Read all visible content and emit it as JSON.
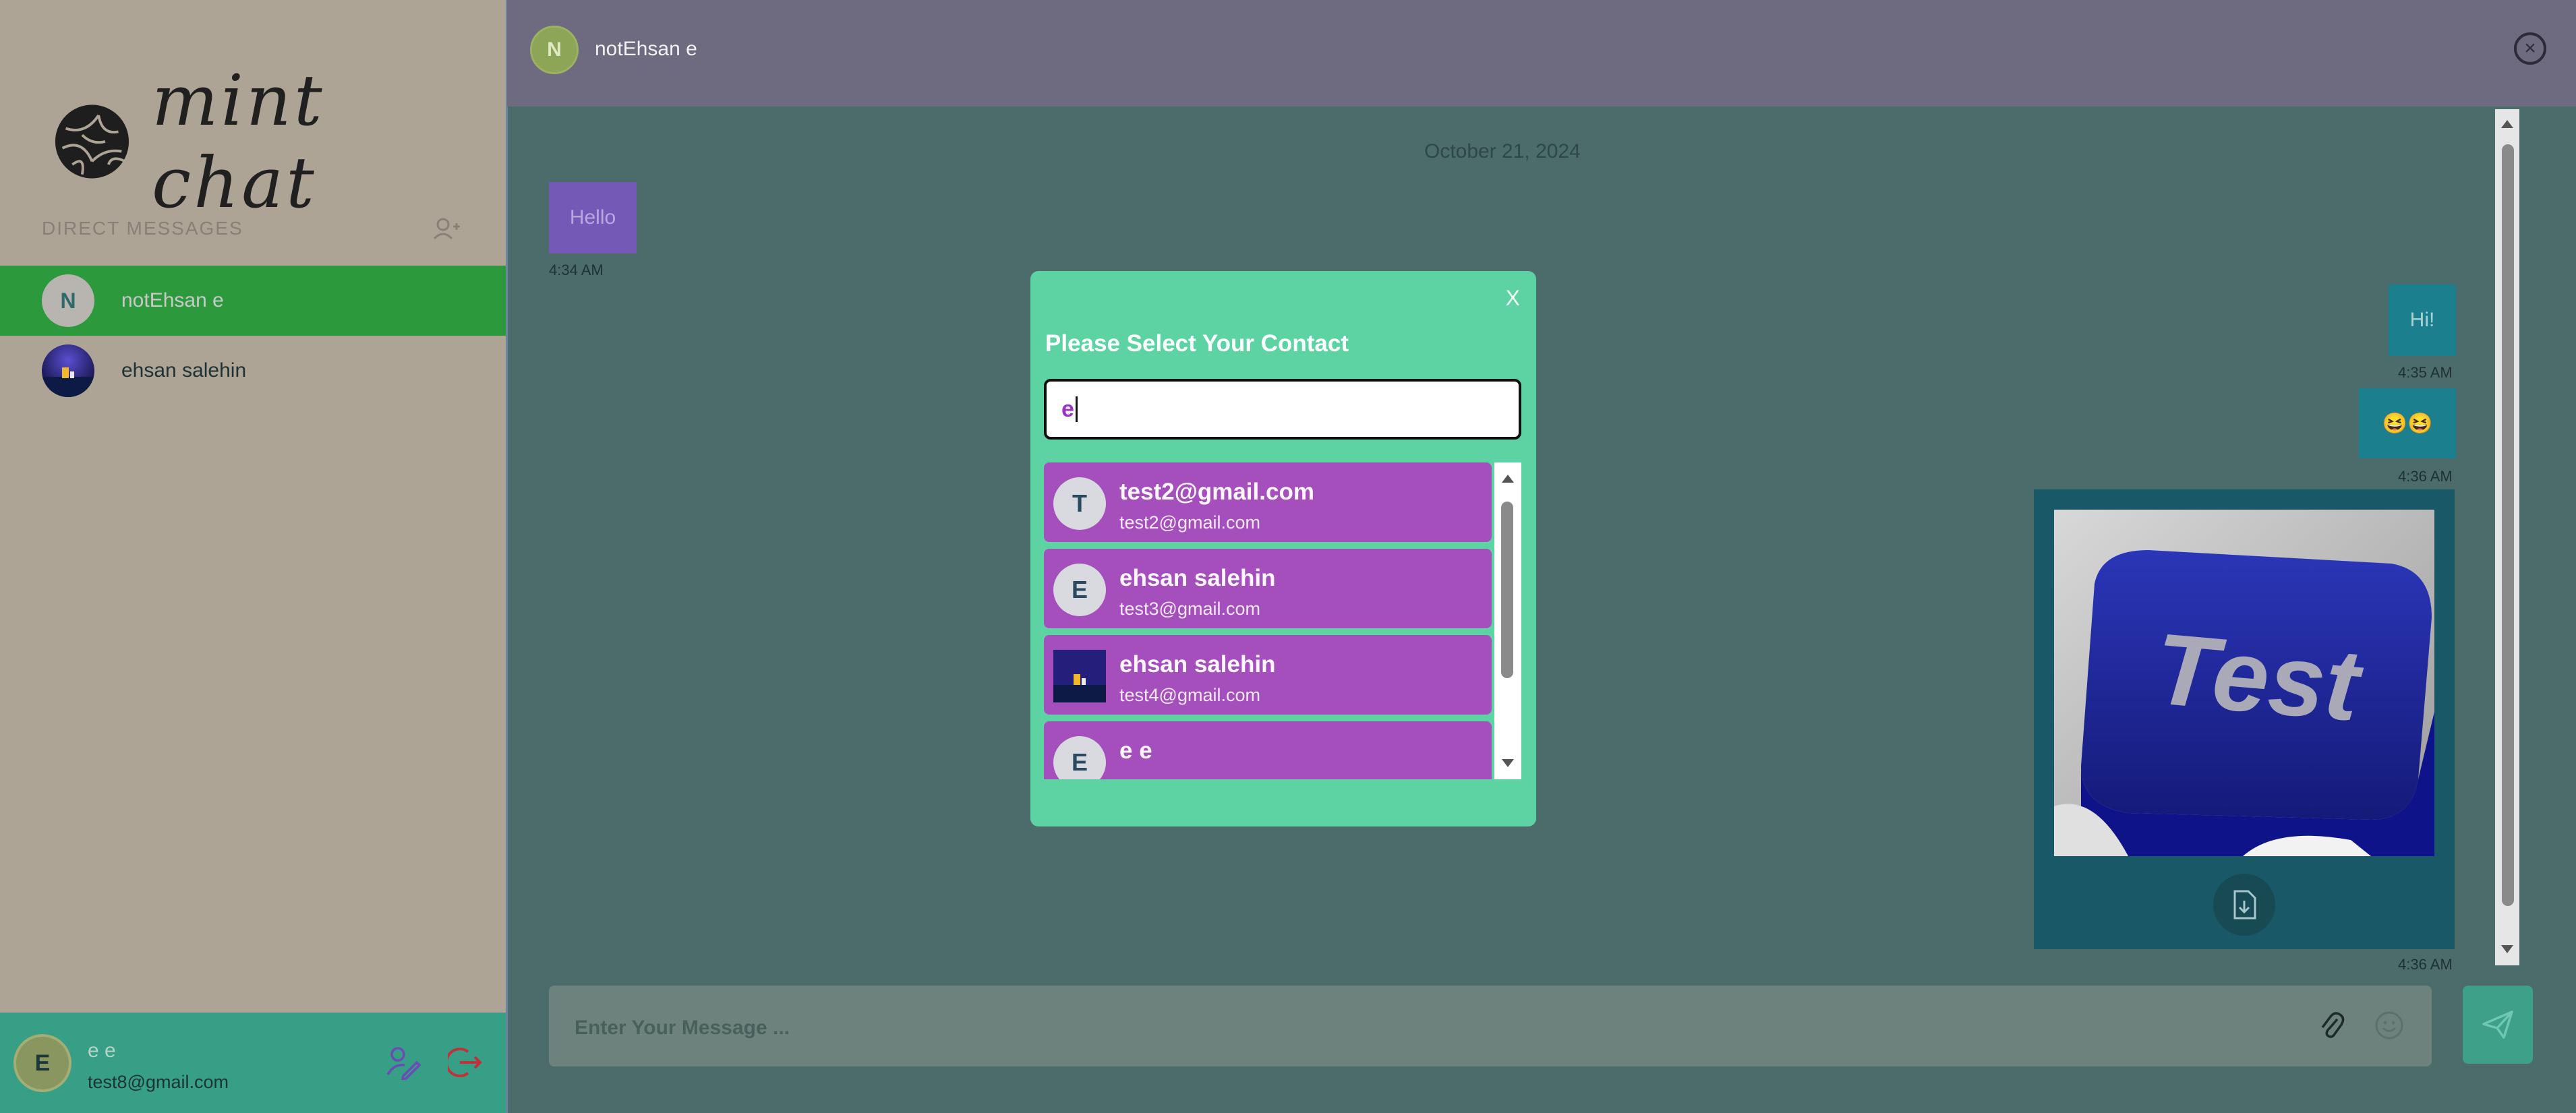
{
  "app": {
    "name": "mint chat"
  },
  "sidebar": {
    "section_title": "DIRECT MESSAGES",
    "contacts": [
      {
        "initial": "N",
        "name": "notEhsan e",
        "active": true
      },
      {
        "initial": "",
        "name": "ehsan salehin",
        "active": false
      }
    ],
    "user": {
      "initial": "E",
      "name": "e e",
      "email": "test8@gmail.com"
    }
  },
  "chat": {
    "header": {
      "initial": "N",
      "name": "notEhsan e"
    },
    "date_label": "October 21, 2024",
    "messages": [
      {
        "direction": "in",
        "text": "Hello",
        "time": "4:34 AM"
      },
      {
        "direction": "out",
        "text": "Hi!",
        "time": "4:35 AM"
      },
      {
        "direction": "out",
        "text": "😆😆",
        "time": "4:36 AM"
      },
      {
        "direction": "out",
        "type": "image",
        "image_text": "Test",
        "time": "4:36 AM"
      }
    ],
    "input": {
      "placeholder": "Enter Your Message ..."
    }
  },
  "modal": {
    "close_label": "X",
    "title": "Please Select Your Contact",
    "search_value": "e",
    "results": [
      {
        "initial": "T",
        "name": "test2@gmail.com",
        "email": "test2@gmail.com"
      },
      {
        "initial": "E",
        "name": "ehsan salehin",
        "email": "test3@gmail.com"
      },
      {
        "initial": "",
        "name": "ehsan salehin",
        "email": "test4@gmail.com"
      },
      {
        "initial": "E",
        "name": "e e",
        "email": ""
      }
    ]
  },
  "icons": {
    "logo": "mint-chat-logo-icon",
    "add_contact": "add-user-icon",
    "edit_profile": "edit-profile-icon",
    "logout": "logout-icon",
    "close_chat": "close-circle-icon",
    "attach": "paperclip-icon",
    "emoji": "emoji-icon",
    "send": "send-icon",
    "download": "download-file-icon"
  }
}
